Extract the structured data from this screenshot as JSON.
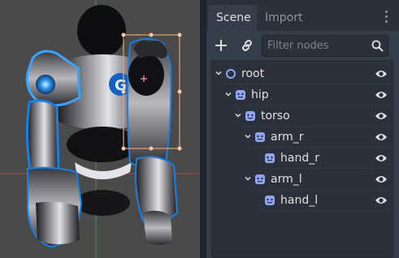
{
  "viewport": {
    "colors": {
      "background": "#4a4a4a",
      "selection_box": "#e8a070",
      "axis_x": "#a04a4a",
      "axis_y": "#5a8a5a",
      "glow": "#3aa2ff"
    }
  },
  "dock": {
    "tabs": [
      {
        "label": "Scene",
        "active": true
      },
      {
        "label": "Import",
        "active": false
      }
    ],
    "menu_icon": "vertical-ellipsis-icon",
    "toolbar": {
      "add_icon": "plus-icon",
      "link_icon": "chain-link-icon",
      "filter_placeholder": "Filter nodes",
      "search_icon": "magnifier-icon"
    },
    "tree": {
      "nodes": [
        {
          "name": "root",
          "type": "Node2D",
          "icon": "circle-node-icon",
          "depth": 0,
          "expanded": true
        },
        {
          "name": "hip",
          "type": "Sprite",
          "icon": "sprite-icon",
          "depth": 1,
          "expanded": true
        },
        {
          "name": "torso",
          "type": "Sprite",
          "icon": "sprite-icon",
          "depth": 2,
          "expanded": true
        },
        {
          "name": "arm_r",
          "type": "Sprite",
          "icon": "sprite-icon",
          "depth": 3,
          "expanded": true
        },
        {
          "name": "hand_r",
          "type": "Sprite",
          "icon": "sprite-icon",
          "depth": 4,
          "expanded": null
        },
        {
          "name": "arm_l",
          "type": "Sprite",
          "icon": "sprite-icon",
          "depth": 3,
          "expanded": true
        },
        {
          "name": "hand_l",
          "type": "Sprite",
          "icon": "sprite-icon",
          "depth": 4,
          "expanded": null
        }
      ]
    },
    "colors": {
      "text": "#e0e0e0",
      "icon_blue": "#8da5f3",
      "panel": "#363d4a",
      "tree_bg": "#2b303b"
    }
  }
}
